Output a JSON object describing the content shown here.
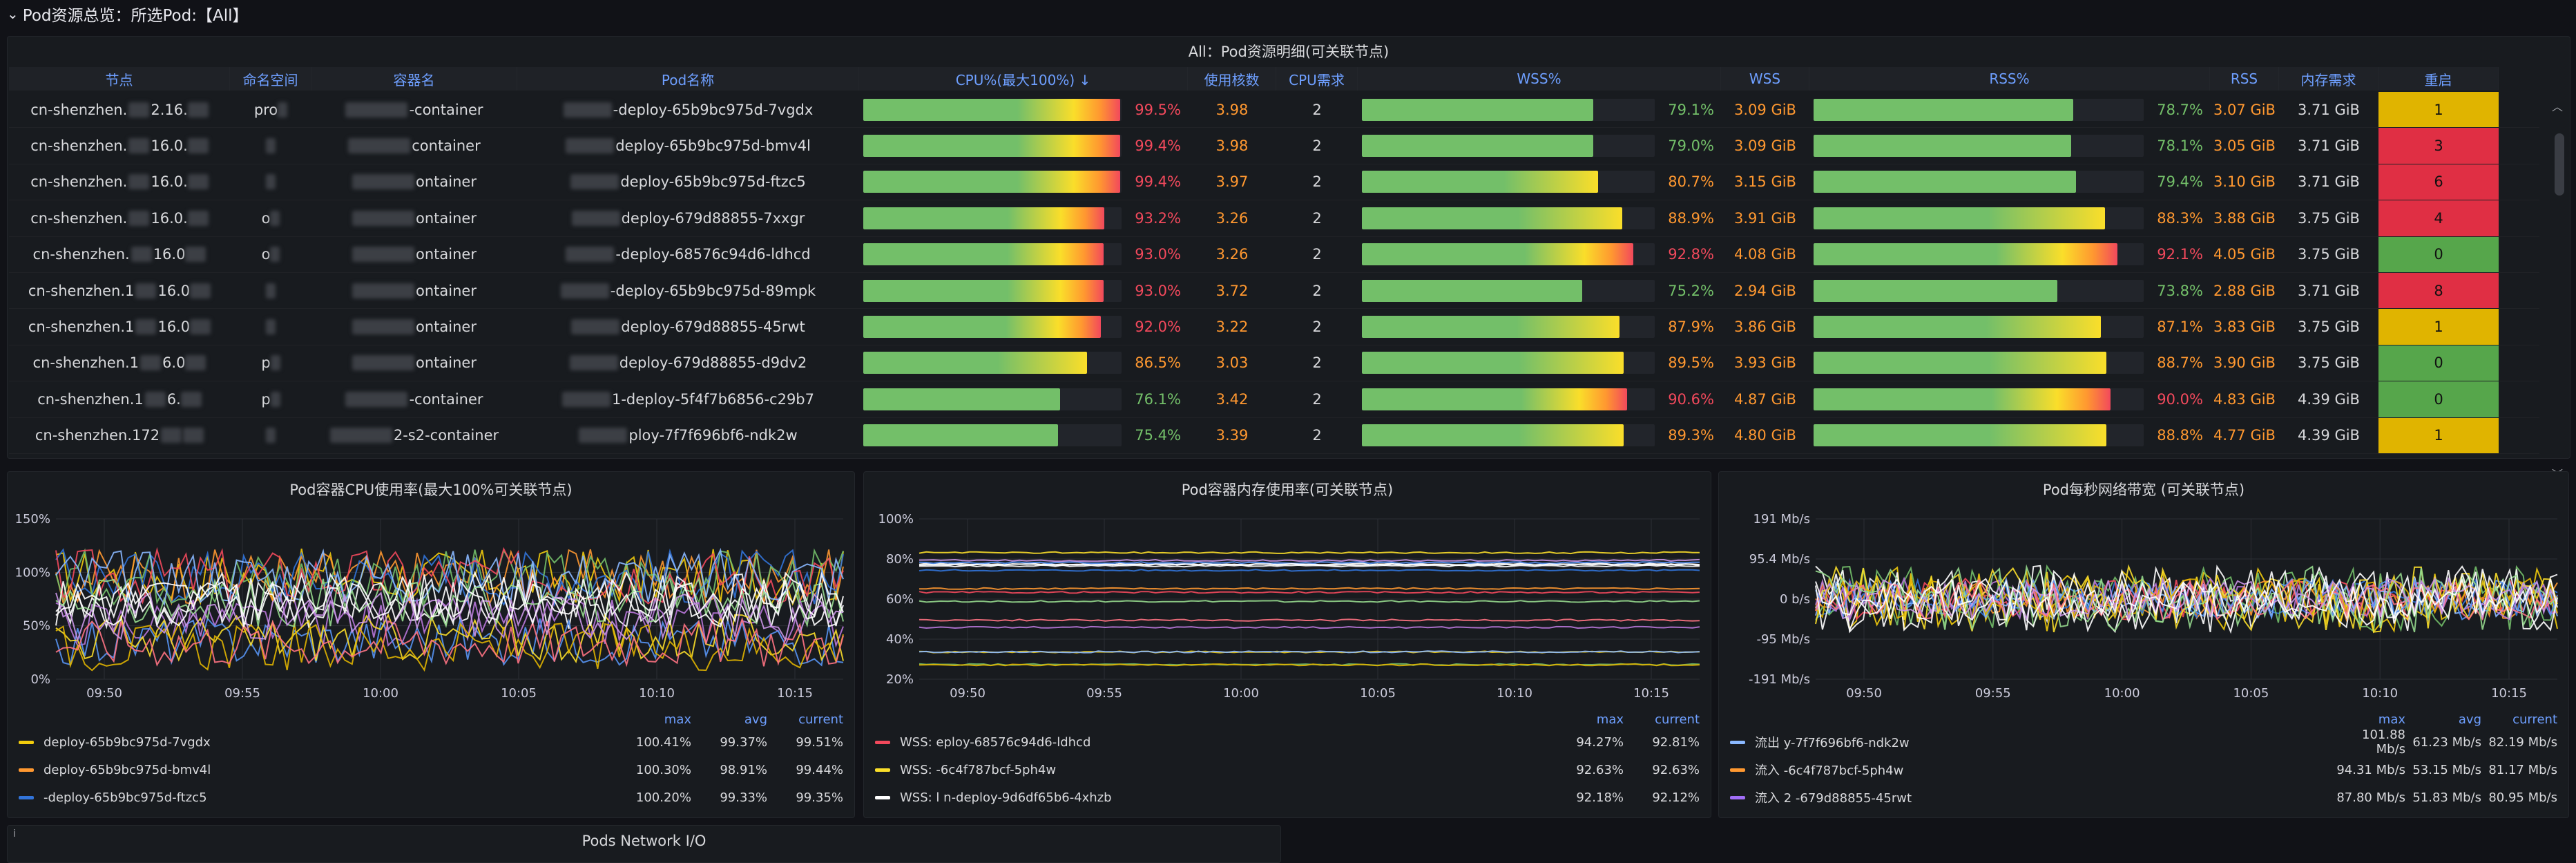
{
  "row": {
    "title": "Pod资源总览：所选Pod:【All】"
  },
  "table": {
    "title": "All：Pod资源明细(可关联节点)",
    "columns": [
      "节点",
      "命名空间",
      "容器名",
      "Pod名称",
      "CPU%(最大100%) ↓",
      "使用核数",
      "CPU需求",
      "WSS%",
      "WSS",
      "RSS%",
      "RSS",
      "内存需求",
      "重启"
    ],
    "rows": [
      {
        "node": "cn-shenzhen.",
        "node2": "2.16.",
        "ns": "pro",
        "container": "-container",
        "pod": "-deploy-65b9bc975d-7vgdx",
        "cpu": "99.5%",
        "cpu_v": 0.995,
        "cores": "3.98",
        "req": "2",
        "wssp": "79.1%",
        "wssp_v": 0.791,
        "wss": "3.09 GiB",
        "rssp": "78.7%",
        "rssp_v": 0.787,
        "rss": "3.07 GiB",
        "memreq": "3.71 GiB",
        "restart": "1"
      },
      {
        "node": "cn-shenzhen.",
        "node2": "16.0.",
        "ns": "",
        "container": "container",
        "pod": "deploy-65b9bc975d-bmv4l",
        "cpu": "99.4%",
        "cpu_v": 0.994,
        "cores": "3.98",
        "req": "2",
        "wssp": "79.0%",
        "wssp_v": 0.79,
        "wss": "3.09 GiB",
        "rssp": "78.1%",
        "rssp_v": 0.781,
        "rss": "3.05 GiB",
        "memreq": "3.71 GiB",
        "restart": "3"
      },
      {
        "node": "cn-shenzhen.",
        "node2": "16.0.",
        "ns": "",
        "container": "ontainer",
        "pod": "deploy-65b9bc975d-ftzc5",
        "cpu": "99.4%",
        "cpu_v": 0.994,
        "cores": "3.97",
        "req": "2",
        "wssp": "80.7%",
        "wssp_v": 0.807,
        "wss": "3.15 GiB",
        "rssp": "79.4%",
        "rssp_v": 0.794,
        "rss": "3.10 GiB",
        "memreq": "3.71 GiB",
        "restart": "6"
      },
      {
        "node": "cn-shenzhen.",
        "node2": "16.0.",
        "ns": "o",
        "container": "ontainer",
        "pod": "deploy-679d88855-7xxgr",
        "cpu": "93.2%",
        "cpu_v": 0.932,
        "cores": "3.26",
        "req": "2",
        "wssp": "88.9%",
        "wssp_v": 0.889,
        "wss": "3.91 GiB",
        "rssp": "88.3%",
        "rssp_v": 0.883,
        "rss": "3.88 GiB",
        "memreq": "3.75 GiB",
        "restart": "4"
      },
      {
        "node": "cn-shenzhen.",
        "node2": "16.0",
        "ns": "o",
        "container": "ontainer",
        "pod": "-deploy-68576c94d6-ldhcd",
        "cpu": "93.0%",
        "cpu_v": 0.93,
        "cores": "3.26",
        "req": "2",
        "wssp": "92.8%",
        "wssp_v": 0.928,
        "wss": "4.08 GiB",
        "rssp": "92.1%",
        "rssp_v": 0.921,
        "rss": "4.05 GiB",
        "memreq": "3.75 GiB",
        "restart": "0"
      },
      {
        "node": "cn-shenzhen.1",
        "node2": "16.0",
        "ns": "",
        "container": "ontainer",
        "pod": "-deploy-65b9bc975d-89mpk",
        "cpu": "93.0%",
        "cpu_v": 0.93,
        "cores": "3.72",
        "req": "2",
        "wssp": "75.2%",
        "wssp_v": 0.752,
        "wss": "2.94 GiB",
        "rssp": "73.8%",
        "rssp_v": 0.738,
        "rss": "2.88 GiB",
        "memreq": "3.71 GiB",
        "restart": "8"
      },
      {
        "node": "cn-shenzhen.1",
        "node2": "16.0",
        "ns": "",
        "container": "ontainer",
        "pod": "deploy-679d88855-45rwt",
        "cpu": "92.0%",
        "cpu_v": 0.92,
        "cores": "3.22",
        "req": "2",
        "wssp": "87.9%",
        "wssp_v": 0.879,
        "wss": "3.86 GiB",
        "rssp": "87.1%",
        "rssp_v": 0.871,
        "rss": "3.83 GiB",
        "memreq": "3.75 GiB",
        "restart": "1"
      },
      {
        "node": "cn-shenzhen.1",
        "node2": "6.0",
        "ns": "p",
        "container": "ontainer",
        "pod": "deploy-679d88855-d9dv2",
        "cpu": "86.5%",
        "cpu_v": 0.865,
        "cores": "3.03",
        "req": "2",
        "wssp": "89.5%",
        "wssp_v": 0.895,
        "wss": "3.93 GiB",
        "rssp": "88.7%",
        "rssp_v": 0.887,
        "rss": "3.90 GiB",
        "memreq": "3.75 GiB",
        "restart": "0"
      },
      {
        "node": "cn-shenzhen.1",
        "node2": "6.",
        "ns": "p",
        "container": "-container",
        "pod": "1-deploy-5f4f7b6856-c29b7",
        "cpu": "76.1%",
        "cpu_v": 0.761,
        "cores": "3.42",
        "req": "2",
        "wssp": "90.6%",
        "wssp_v": 0.906,
        "wss": "4.87 GiB",
        "rssp": "90.0%",
        "rssp_v": 0.9,
        "rss": "4.83 GiB",
        "memreq": "4.39 GiB",
        "restart": "0"
      },
      {
        "node": "cn-shenzhen.172",
        "node2": "",
        "ns": "",
        "container": "2-s2-container",
        "pod": "ploy-7f7f696bf6-ndk2w",
        "cpu": "75.4%",
        "cpu_v": 0.754,
        "cores": "3.39",
        "req": "2",
        "wssp": "89.3%",
        "wssp_v": 0.893,
        "wss": "4.80 GiB",
        "rssp": "88.8%",
        "rssp_v": 0.888,
        "rss": "4.77 GiB",
        "memreq": "4.39 GiB",
        "restart": "1"
      }
    ]
  },
  "charts": [
    {
      "title": "Pod容器CPU使用率(最大100%可关联节点)",
      "legend_headers": [
        "max",
        "avg",
        "current"
      ],
      "legend": [
        {
          "name": "deploy-65b9bc975d-7vgdx",
          "color": "#f2cc0c",
          "max": "100.41%",
          "avg": "99.37%",
          "current": "99.51%"
        },
        {
          "name": "deploy-65b9bc975d-bmv4l",
          "color": "#ff9830",
          "max": "100.30%",
          "avg": "98.91%",
          "current": "99.44%"
        },
        {
          "name": "-deploy-65b9bc975d-ftzc5",
          "color": "#3274d9",
          "max": "100.20%",
          "avg": "99.33%",
          "current": "99.35%"
        }
      ],
      "chart_data": {
        "type": "line",
        "yticks": [
          "150%",
          "100%",
          "50%",
          "0%"
        ],
        "xticks": [
          "09:50",
          "09:55",
          "10:00",
          "10:05",
          "10:10",
          "10:15"
        ],
        "ylim": [
          0,
          150
        ]
      }
    },
    {
      "title": "Pod容器内存使用率(可关联节点)",
      "legend_headers": [
        "max",
        "current"
      ],
      "legend": [
        {
          "name": "WSS: eploy-68576c94d6-ldhcd",
          "color": "#f2495c",
          "max": "94.27%",
          "current": "92.81%"
        },
        {
          "name": "WSS: -6c4f787bcf-5ph4w",
          "color": "#fade2a",
          "max": "92.63%",
          "current": "92.63%"
        },
        {
          "name": "WSS: l n-deploy-9d6df65b6-4xhzb",
          "color": "#ffffff",
          "max": "92.18%",
          "current": "92.12%"
        }
      ],
      "chart_data": {
        "type": "line",
        "yticks": [
          "100%",
          "80%",
          "60%",
          "40%",
          "20%"
        ],
        "xticks": [
          "09:50",
          "09:55",
          "10:00",
          "10:05",
          "10:10",
          "10:15"
        ],
        "ylim": [
          20,
          100
        ]
      }
    },
    {
      "title": "Pod每秒网络带宽 (可关联节点)",
      "legend_headers": [
        "max",
        "avg",
        "current"
      ],
      "legend": [
        {
          "name": "流出 y-7f7f696bf6-ndk2w",
          "color": "#8ab8ff",
          "max": "101.88 Mb/s",
          "avg": "61.23 Mb/s",
          "current": "82.19 Mb/s"
        },
        {
          "name": "流入 -6c4f787bcf-5ph4w",
          "color": "#ff9830",
          "max": "94.31 Mb/s",
          "avg": "53.15 Mb/s",
          "current": "81.17 Mb/s"
        },
        {
          "name": "流入 2 -679d88855-45rwt",
          "color": "#a16ef7",
          "max": "87.80 Mb/s",
          "avg": "51.83 Mb/s",
          "current": "80.95 Mb/s"
        }
      ],
      "chart_data": {
        "type": "line",
        "yticks": [
          "191 Mb/s",
          "95.4 Mb/s",
          "0 b/s",
          "-95 Mb/s",
          "-191 Mb/s"
        ],
        "xticks": [
          "09:50",
          "09:55",
          "10:00",
          "10:05",
          "10:10",
          "10:15"
        ],
        "ylim": [
          -191,
          191
        ]
      }
    }
  ],
  "bottom": {
    "title": "Pods Network I/O",
    "icon": "info-icon"
  },
  "colors": {
    "green": "#73bf69",
    "yellow": "#fade2a",
    "orange": "#ff9830",
    "red": "#f2495c",
    "blue": "#6e9fff"
  }
}
